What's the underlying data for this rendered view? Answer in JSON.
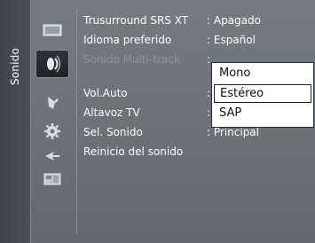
{
  "sidebar": {
    "title": "Sonido"
  },
  "icons": [
    {
      "name": "picture-icon"
    },
    {
      "name": "sound-icon"
    },
    {
      "name": "channel-icon"
    },
    {
      "name": "setup-icon"
    },
    {
      "name": "input-icon"
    },
    {
      "name": "application-icon"
    }
  ],
  "menu": {
    "items": [
      {
        "label": "Trusurround SRS XT",
        "value": ": Apagado"
      },
      {
        "label": "Idioma preferido",
        "value": ": Español"
      },
      {
        "label": "Sonido Multi-track",
        "value": ":"
      },
      {
        "label": "Vol.Auto",
        "value": ":"
      },
      {
        "label": "Altavoz TV",
        "value": ":"
      },
      {
        "label": "Sel. Sonido",
        "value": ": Principal"
      },
      {
        "label": "Reinicio del sonido",
        "value": ""
      }
    ]
  },
  "dropdown": {
    "options": [
      "Mono",
      "Estéreo",
      "SAP"
    ],
    "selected": "Estéreo"
  }
}
